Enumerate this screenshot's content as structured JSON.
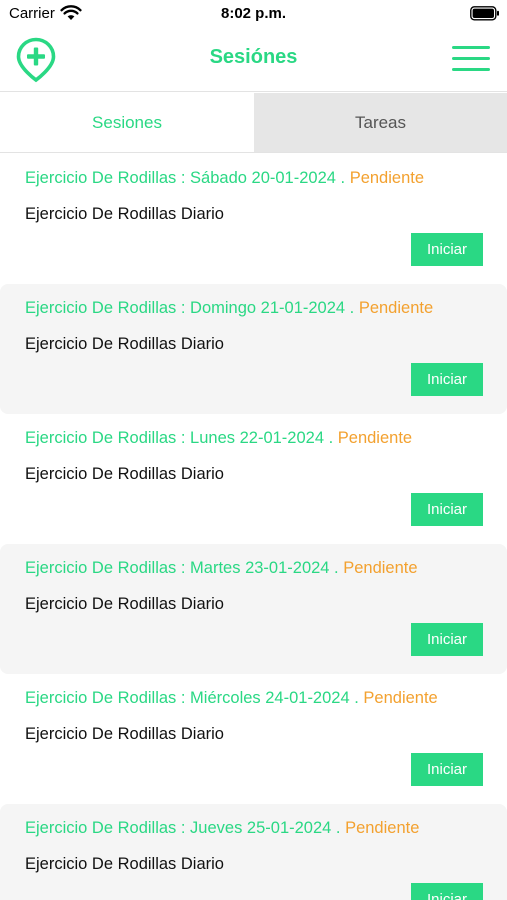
{
  "status_bar": {
    "carrier": "Carrier",
    "time": "8:02 p.m.",
    "icons": [
      "wifi-icon",
      "battery-icon"
    ]
  },
  "header": {
    "title": "Sesiónes",
    "left_icon": "add-location-pin-icon",
    "right_icon": "hamburger-menu-icon",
    "accent_color": "#2ad884"
  },
  "tabs": [
    {
      "label": "Sesiones",
      "active": true
    },
    {
      "label": "Tareas",
      "active": false
    }
  ],
  "sessions": [
    {
      "title": "Ejercicio De Rodillas : Sábado 20-01-2024 . ",
      "status": "Pendiente",
      "description": "Ejercicio De Rodillas Diario",
      "button": "Iniciar"
    },
    {
      "title": "Ejercicio De Rodillas : Domingo 21-01-2024 . ",
      "status": "Pendiente",
      "description": "Ejercicio De Rodillas Diario",
      "button": "Iniciar"
    },
    {
      "title": "Ejercicio De Rodillas : Lunes 22-01-2024 . ",
      "status": "Pendiente",
      "description": "Ejercicio De Rodillas Diario",
      "button": "Iniciar"
    },
    {
      "title": "Ejercicio De Rodillas : Martes 23-01-2024 . ",
      "status": "Pendiente",
      "description": "Ejercicio De Rodillas Diario",
      "button": "Iniciar"
    },
    {
      "title": "Ejercicio De Rodillas : Miércoles 24-01-2024 . ",
      "status": "Pendiente",
      "description": "Ejercicio De Rodillas Diario",
      "button": "Iniciar"
    },
    {
      "title": "Ejercicio De Rodillas : Jueves 25-01-2024 . ",
      "status": "Pendiente",
      "description": "Ejercicio De Rodillas Diario",
      "button": "Iniciar"
    }
  ],
  "colors": {
    "accent": "#2ad884",
    "status_pending": "#f3a12f",
    "card_alt_bg": "#f5f5f5",
    "tab_inactive_bg": "#e6e6e6"
  }
}
